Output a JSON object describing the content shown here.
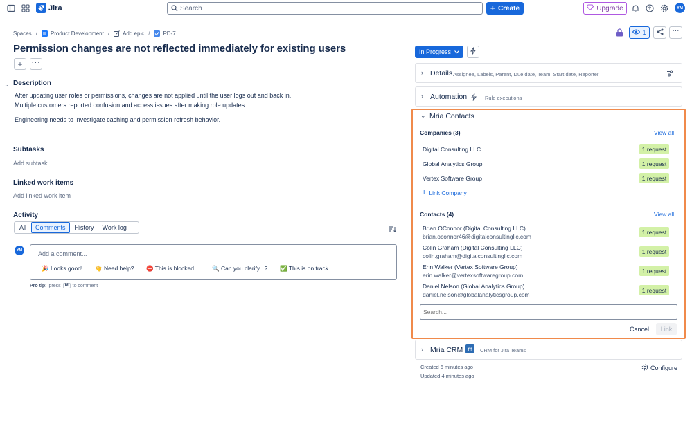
{
  "topbar": {
    "app_name": "Jira",
    "search_placeholder": "Search",
    "create_label": "Create",
    "upgrade_label": "Upgrade",
    "avatar_initials": "YM"
  },
  "breadcrumb": {
    "spaces": "Spaces",
    "project": "Product Development",
    "add_epic": "Add epic",
    "issue_key": "PD-7"
  },
  "issue": {
    "title": "Permission changes are not reflected immediately for existing users",
    "description_heading": "Description",
    "description_lines": [
      "After updating user roles or permissions, changes are not applied until the user logs out and back in.",
      "Multiple customers reported confusion and access issues after making role updates.",
      "Engineering needs to investigate caching and permission refresh behavior."
    ],
    "subtasks_heading": "Subtasks",
    "add_subtask": "Add subtask",
    "linked_heading": "Linked work items",
    "add_linked": "Add linked work item"
  },
  "activity": {
    "heading": "Activity",
    "tabs": [
      "All",
      "Comments",
      "History",
      "Work log"
    ],
    "active_tab": "Comments",
    "comment_placeholder": "Add a comment...",
    "quick_replies": [
      {
        "emoji_color": "#f5cd47",
        "label": "🎉 Looks good!"
      },
      {
        "emoji_color": "#f5cd47",
        "label": "👋 Need help?"
      },
      {
        "emoji_color": "#e2483d",
        "label": "⛔ This is blocked..."
      },
      {
        "emoji_color": "#8590a2",
        "label": "🔍 Can you clarify...?"
      },
      {
        "emoji_color": "#22a06b",
        "label": "✅ This is on track"
      }
    ],
    "pro_tip_label": "Pro tip:",
    "pro_tip_press": "press",
    "pro_tip_key": "M",
    "pro_tip_suffix": "to comment"
  },
  "sidebar": {
    "watch_count": "1",
    "status": "In Progress",
    "details_title": "Details",
    "details_subtitle": "Assignee, Labels, Parent, Due date, Team, Start date, Reporter",
    "automation_title": "Automation",
    "automation_subtitle": "Rule executions",
    "mria_contacts_title": "Mria Contacts",
    "companies_heading": "Companies (3)",
    "view_all": "View all",
    "companies": [
      {
        "name": "Digital Consulting LLC",
        "requests": "1 request"
      },
      {
        "name": "Global Analytics Group",
        "requests": "1 request"
      },
      {
        "name": "Vertex Software Group",
        "requests": "1 request"
      }
    ],
    "link_company": "Link Company",
    "contacts_heading": "Contacts (4)",
    "contacts": [
      {
        "name": "Brian OConnor (Digital Consulting LLC)",
        "email": "brian.oconnor46@digitalconsultingllc.com",
        "requests": "1 request"
      },
      {
        "name": "Colin Graham (Digital Consulting LLC)",
        "email": "colin.graham@digitalconsultingllc.com",
        "requests": "1 request"
      },
      {
        "name": "Erin Walker (Vertex Software Group)",
        "email": "erin.walker@vertexsoftwaregroup.com",
        "requests": "1 request"
      },
      {
        "name": "Daniel Nelson (Global Analytics Group)",
        "email": "daniel.nelson@globalanalyticsgroup.com",
        "requests": "1 request"
      }
    ],
    "contact_search_placeholder": "Search...",
    "cancel_label": "Cancel",
    "link_label": "Link",
    "crm_title": "Mria CRM",
    "crm_logo_letter": "m",
    "crm_subtitle": "CRM for Jira Teams",
    "created": "Created 6 minutes ago",
    "updated": "Updated 4 minutes ago",
    "configure": "Configure"
  },
  "colors": {
    "brand_blue": "#1868db",
    "highlight_orange": "#f08a4b",
    "badge_green": "#d3f1a7"
  }
}
